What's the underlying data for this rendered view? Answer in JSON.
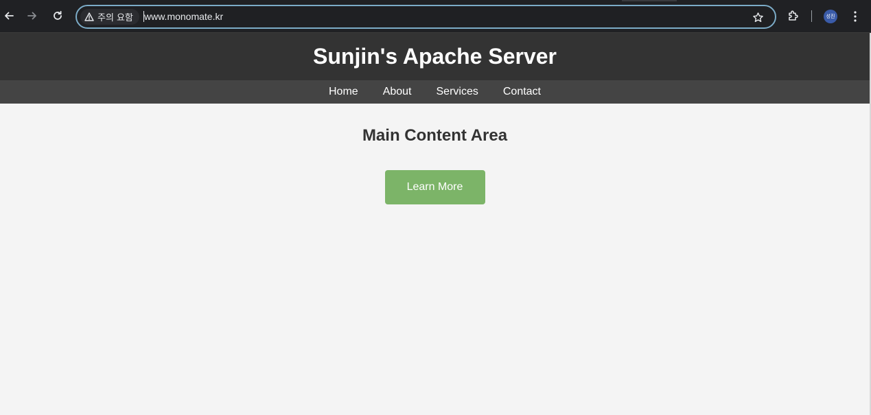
{
  "browser": {
    "security_label": "주의 요함",
    "url": "www.monomate.kr",
    "profile_initials": "성진",
    "icons": {
      "back": "arrow-left-icon",
      "forward": "arrow-right-icon",
      "reload": "reload-icon",
      "warning": "warning-triangle-icon",
      "bookmark": "star-icon",
      "extensions": "puzzle-icon",
      "menu": "kebab-menu-icon"
    }
  },
  "site": {
    "title": "Sunjin's Apache Server",
    "nav": {
      "items": [
        {
          "label": "Home"
        },
        {
          "label": "About"
        },
        {
          "label": "Services"
        },
        {
          "label": "Contact"
        }
      ]
    },
    "main": {
      "heading": "Main Content Area",
      "button_label": "Learn More"
    }
  },
  "colors": {
    "header_bg": "#333333",
    "nav_bg": "#444444",
    "page_bg": "#f4f4f4",
    "button_bg": "#7cb468",
    "omnibox_border": "#7cacc8"
  }
}
